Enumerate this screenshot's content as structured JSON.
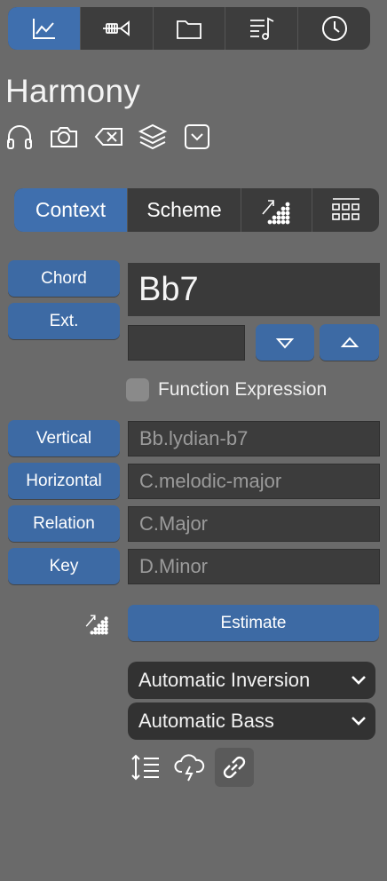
{
  "topbar": {
    "tabs": [
      {
        "name": "chart-icon",
        "active": true
      },
      {
        "name": "trumpet-icon",
        "active": false
      },
      {
        "name": "folder-icon",
        "active": false
      },
      {
        "name": "music-list-icon",
        "active": false
      },
      {
        "name": "clock-icon",
        "active": false
      }
    ]
  },
  "panel": {
    "title": "Harmony",
    "tools": [
      "headphones-icon",
      "camera-icon",
      "delete-icon",
      "layers-icon",
      "dropdown-box-icon"
    ]
  },
  "segments": {
    "context_label": "Context",
    "scheme_label": "Scheme",
    "icon3": "chart-dots-icon",
    "icon4": "grid-icon"
  },
  "chord": {
    "chord_label": "Chord",
    "ext_label": "Ext.",
    "chord_value": "Bb7",
    "ext_value": "",
    "function_expression_label": "Function Expression",
    "function_expression_checked": false
  },
  "scales": {
    "vertical_label": "Vertical",
    "vertical_value": "Bb.lydian-b7",
    "horizontal_label": "Horizontal",
    "horizontal_value": "C.melodic-major",
    "relation_label": "Relation",
    "relation_value": "C.Major",
    "key_label": "Key",
    "key_value": "D.Minor"
  },
  "estimate": {
    "label": "Estimate"
  },
  "selects": {
    "inversion": "Automatic Inversion",
    "bass": "Automatic Bass"
  },
  "bottom": [
    "line-spacing-icon",
    "storm-cloud-icon",
    "link-icon"
  ],
  "colors": {
    "background": "#6a6a6a",
    "accent": "#3f6fae",
    "button": "#3d6aa4",
    "field": "#3c3c3c",
    "dark": "#3b3b3b"
  }
}
